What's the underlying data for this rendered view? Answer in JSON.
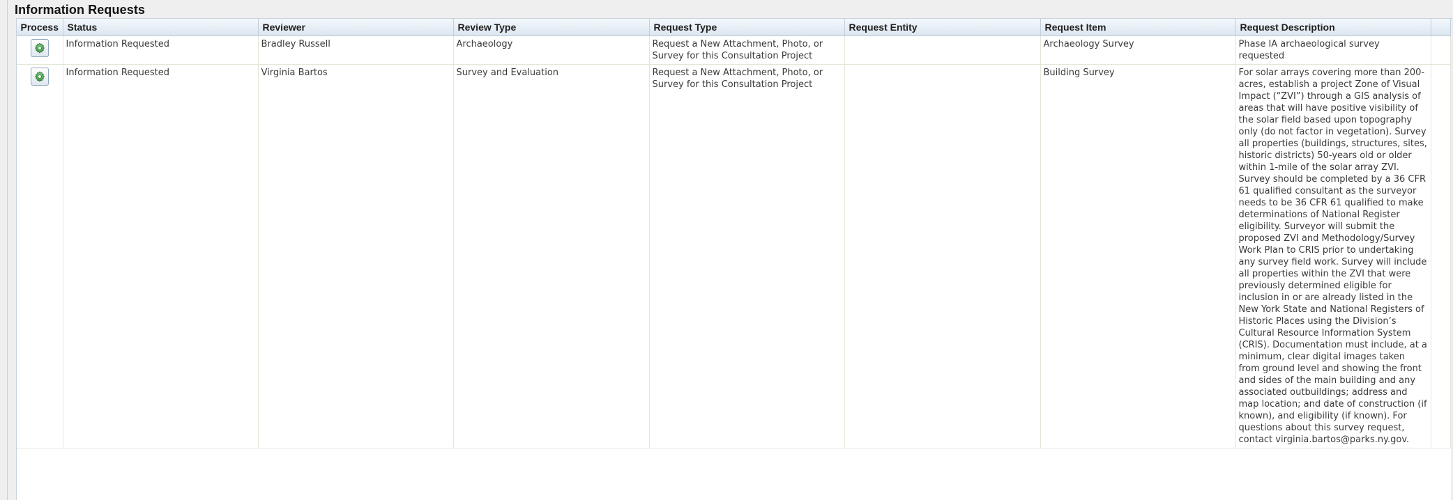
{
  "panel": {
    "title": "Information Requests"
  },
  "colors": {
    "header_top": "#f4f8fc",
    "header_bottom": "#dce6f0",
    "gear_green": "#3f9a47",
    "grid_line": "#e3e7d8"
  },
  "table": {
    "headers": {
      "process": "Process",
      "status": "Status",
      "reviewer": "Reviewer",
      "review_type": "Review Type",
      "request_type": "Request Type",
      "request_entity": "Request Entity",
      "request_item": "Request Item",
      "request_description": "Request Description"
    },
    "rows": [
      {
        "process_icon": "gear-icon",
        "status": "Information Requested",
        "reviewer": "Bradley Russell",
        "review_type": "Archaeology",
        "request_type": "Request a New Attachment, Photo, or Survey for this Consultation Project",
        "request_entity": "",
        "request_item": "Archaeology Survey",
        "request_description": "Phase IA archaeological survey requested"
      },
      {
        "process_icon": "gear-icon",
        "status": "Information Requested",
        "reviewer": "Virginia Bartos",
        "review_type": "Survey and Evaluation",
        "request_type": "Request a New Attachment, Photo, or Survey for this Consultation Project",
        "request_entity": "",
        "request_item": "Building Survey",
        "request_description": "For solar arrays covering more than 200-acres, establish a project Zone of Visual Impact (“ZVI”) through a GIS analysis of areas that will have positive visibility of the solar field based upon topography only (do not factor in vegetation). Survey all properties (buildings, structures, sites, historic districts) 50-years old or older within 1-mile of the solar array ZVI. Survey should be completed by a 36 CFR 61 qualified consultant as the surveyor needs to be 36 CFR 61 qualified to make determinations of National Register eligibility. Surveyor will submit the proposed ZVI and Methodology/Survey Work Plan to CRIS prior to undertaking any survey field work. Survey will include all properties within the ZVI that were previously determined eligible for inclusion in or are already listed in the New York State and National Registers of Historic Places using the Division’s Cultural Resource Information System (CRIS). Documentation must include, at a minimum, clear digital images taken from ground level and showing the front and sides of the main building and any associated outbuildings; address and map location; and date of construction (if known), and eligibility (if known). For questions about this survey request, contact virginia.bartos@parks.ny.gov."
      }
    ]
  }
}
